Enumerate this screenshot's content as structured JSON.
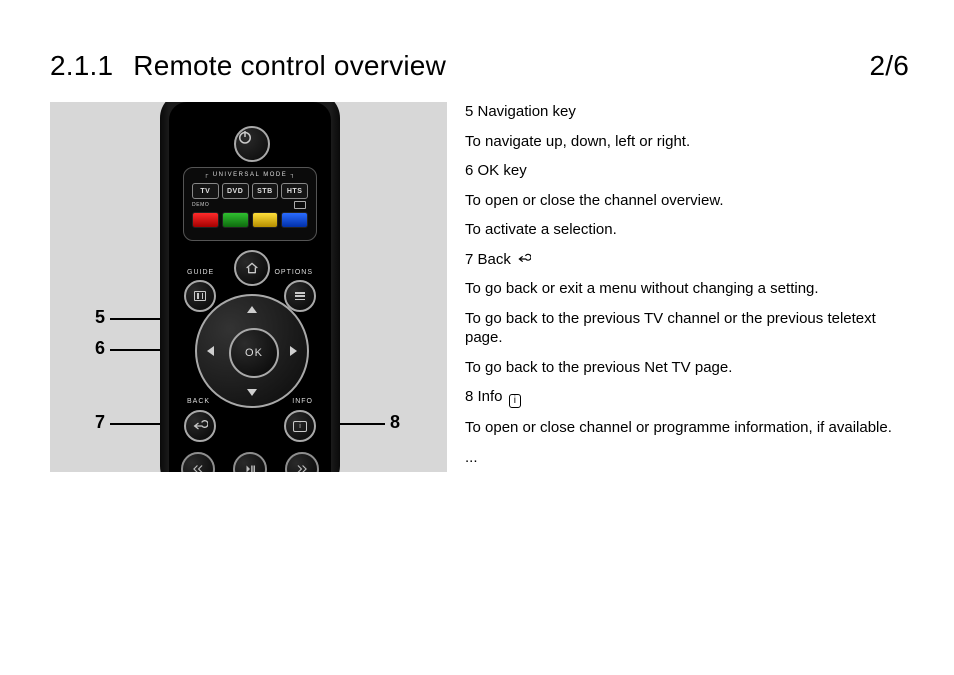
{
  "header": {
    "section_number": "2.1.1",
    "title": "Remote control overview",
    "page_indicator": "2/6"
  },
  "callouts": {
    "five": "5",
    "six": "6",
    "seven": "7",
    "eight": "8"
  },
  "remote": {
    "universal_mode_label": "UNIVERSAL MODE",
    "modes": {
      "tv": "TV",
      "dvd": "DVD",
      "stb": "STB",
      "hts": "HTS"
    },
    "demo_label": "DEMO",
    "labels": {
      "guide": "GUIDE",
      "options": "OPTIONS",
      "back": "BACK",
      "info": "INFO"
    },
    "ok_label": "OK"
  },
  "descriptions": {
    "l1": "5 Navigation key",
    "l2": "To navigate up, down, left or right.",
    "l3": "6 OK key",
    "l4": "To open or close the channel overview.",
    "l5": "To activate a selection.",
    "l6a": "7 Back ",
    "l7": "To go back or exit a menu without changing a setting.",
    "l8": "To go back to the previous TV channel or the previous teletext page.",
    "l9": "To go back to the previous Net TV page.",
    "l10a": "8 Info ",
    "l11": "To open or close channel or programme information, if available.",
    "l12": "..."
  }
}
